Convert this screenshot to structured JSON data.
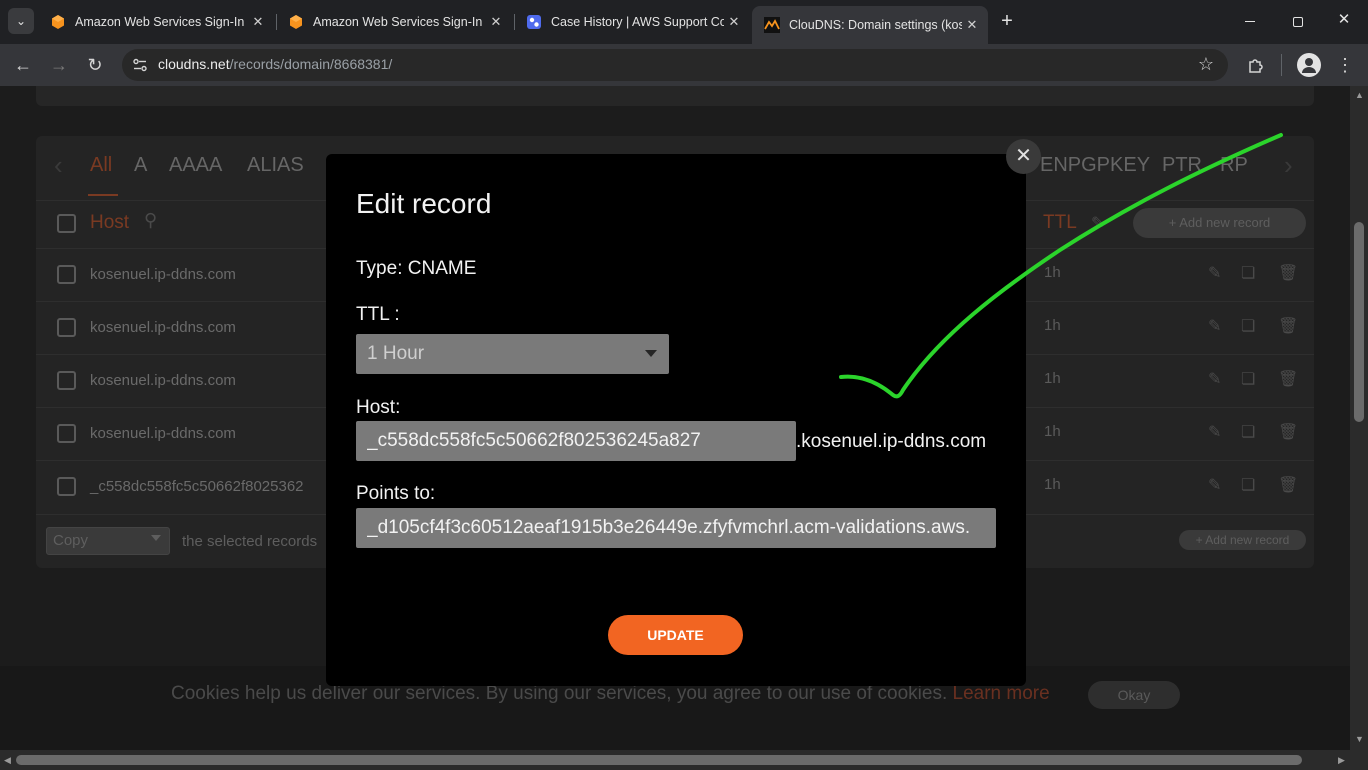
{
  "browser": {
    "tabs": [
      {
        "title": "Amazon Web Services Sign-In",
        "icon": "aws-icon"
      },
      {
        "title": "Amazon Web Services Sign-In",
        "icon": "aws-icon"
      },
      {
        "title": "Case History | AWS Support Cor",
        "icon": "support-icon"
      },
      {
        "title": "ClouDNS: Domain settings (kos",
        "icon": "cloudns-icon"
      }
    ],
    "url_host": "cloudns.net",
    "url_path": "/records/domain/8668381/"
  },
  "record_tabs": [
    "All",
    "A",
    "AAAA",
    "ALIAS",
    "ENPGPKEY",
    "PTR",
    "RP"
  ],
  "table": {
    "host_header": "Host",
    "ttl_header": "TTL",
    "add_record_label": "+ Add new record",
    "rows": [
      {
        "host": "kosenuel.ip-ddns.com",
        "ttl": "1h"
      },
      {
        "host": "kosenuel.ip-ddns.com",
        "ttl": "1h"
      },
      {
        "host": "kosenuel.ip-ddns.com",
        "ttl": "1h"
      },
      {
        "host": "kosenuel.ip-ddns.com",
        "ttl": "1h"
      },
      {
        "host": "_c558dc558fc5c50662f8025362",
        "ttl": "1h"
      }
    ],
    "footer": {
      "copy_select": "Copy",
      "selected_text": "the selected records",
      "add_record_label": "+ Add new record"
    }
  },
  "cookie": {
    "text": "Cookies help us deliver our services. By using our services, you agree to our use of cookies.",
    "link": "Learn more",
    "button": "Okay"
  },
  "modal": {
    "title": "Edit record",
    "type_label": "Type: CNAME",
    "ttl_label": "TTL :",
    "ttl_value": "1 Hour",
    "host_label": "Host:",
    "host_value": "_c558dc558fc5c50662f802536245a827",
    "host_suffix": ".kosenuel.ip-ddns.com",
    "points_label": "Points to:",
    "points_value": "_d105cf4f3c60512aeaf1915b3e26449e.zfyfvmchrl.acm-validations.aws.",
    "update_button": "UPDATE",
    "close_symbol": "✕"
  },
  "colors": {
    "accent": "#f26522",
    "annotation_check": "#2bd42b",
    "modal_bg": "#000000",
    "input_bg": "#7a7a7a"
  }
}
